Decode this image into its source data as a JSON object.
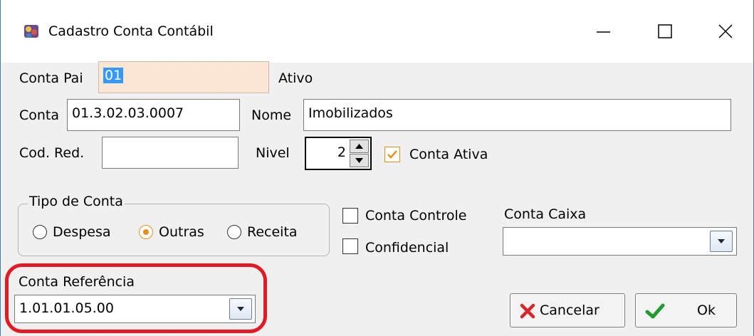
{
  "window": {
    "title": "Cadastro Conta Contábil",
    "icons": {
      "app": "app-icon",
      "minimize": "minimize-icon",
      "maximize": "maximize-icon",
      "close": "close-icon"
    }
  },
  "form": {
    "conta_pai": {
      "label": "Conta Pai",
      "value": "01",
      "status": "Ativo"
    },
    "conta": {
      "label": "Conta",
      "value": "01.3.02.03.0007"
    },
    "nome": {
      "label": "Nome",
      "value": "Imobilizados"
    },
    "cod_red": {
      "label": "Cod. Red.",
      "value": ""
    },
    "nivel": {
      "label": "Nivel",
      "value": "2"
    },
    "conta_ativa": {
      "label": "Conta Ativa",
      "checked": true
    },
    "tipo_conta": {
      "legend": "Tipo de Conta",
      "options": [
        "Despesa",
        "Outras",
        "Receita"
      ],
      "selected": "Outras"
    },
    "conta_controle": {
      "label": "Conta Controle",
      "checked": false
    },
    "confidencial": {
      "label": "Confidencial",
      "checked": false
    },
    "conta_caixa": {
      "label": "Conta Caixa",
      "value": ""
    },
    "conta_referencia": {
      "label": "Conta Referência",
      "value": "1.01.01.05.00"
    }
  },
  "buttons": {
    "cancel": "Cancelar",
    "ok": "Ok"
  },
  "colors": {
    "accent": "#e3911f",
    "highlight": "#e01b24",
    "selection": "#3399ff",
    "readonly_field": "#fbe5d3",
    "window_border": "#3c7fb1"
  }
}
